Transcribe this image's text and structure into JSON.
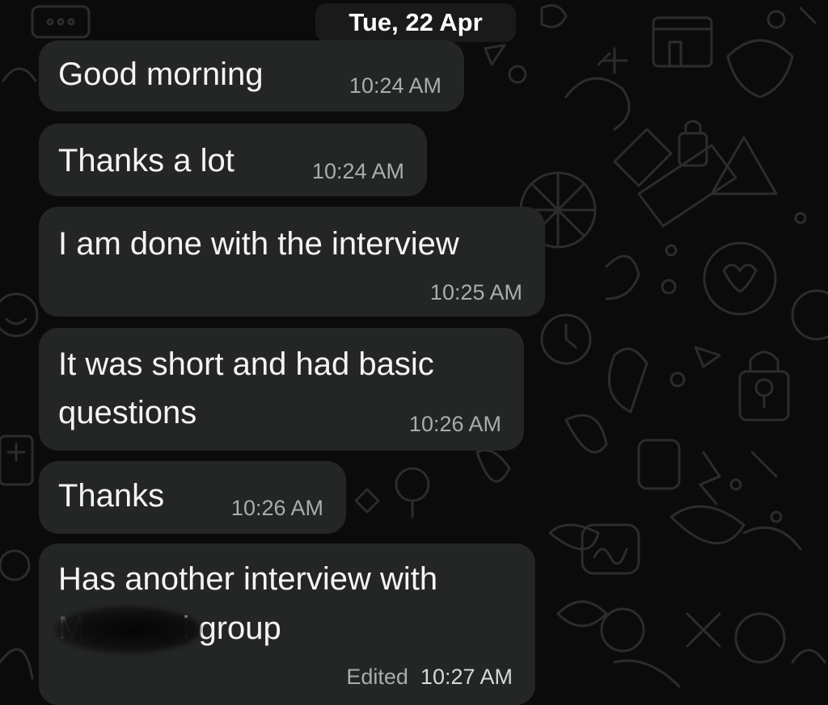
{
  "chat": {
    "date_label": "Tue, 22 Apr",
    "messages": [
      {
        "text": "Good morning",
        "time": "10:24 AM"
      },
      {
        "text": "Thanks a lot",
        "time": "10:24 AM"
      },
      {
        "text": "I am done with the interview",
        "time": "10:25 AM"
      },
      {
        "text_line1": "It was short and had basic",
        "text_line2": "questions",
        "time": "10:26 AM"
      },
      {
        "text": "Thanks",
        "time": "10:26 AM"
      },
      {
        "text_line1": "Has another interview with",
        "text_line2_visible": "ni group",
        "partial_prefix": "M",
        "partial_middle": "anani",
        "edited_label": "Edited",
        "time": "10:27 AM"
      }
    ]
  },
  "theme": {
    "background": "#0b0b0b",
    "bubble": "#242626",
    "timestamp_color": "#a9adae",
    "doodle_color": "#2b2b2b"
  }
}
